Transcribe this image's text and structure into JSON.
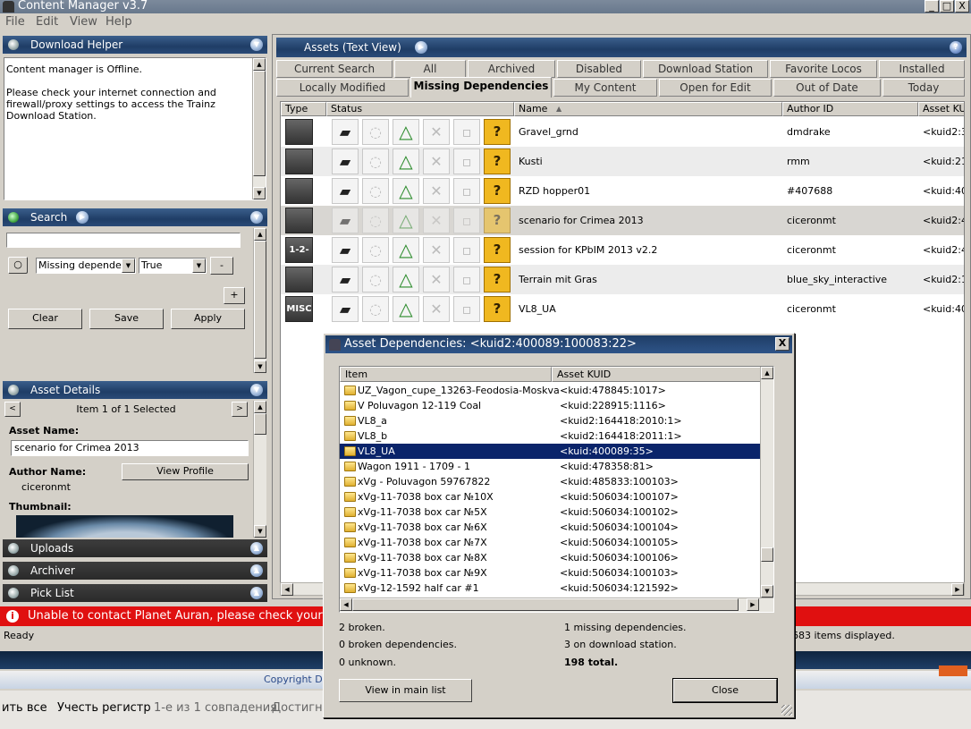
{
  "window": {
    "title": "Content Manager v3.7",
    "min": "_",
    "max": "□",
    "close": "X"
  },
  "menu": [
    "File",
    "Edit",
    "View",
    "Help"
  ],
  "download_helper": {
    "title": "Download Helper",
    "line1": "Content manager is Offline.",
    "line2": "Please check your internet connection and",
    "line3": "firewall/proxy settings to access the Trainz",
    "line4": "Download Station."
  },
  "search": {
    "title": "Search",
    "input_value": "",
    "field": "Missing dependenc",
    "value": "True",
    "minus": "-",
    "plus": "+",
    "clear": "Clear",
    "save": "Save",
    "apply": "Apply"
  },
  "asset_details": {
    "title": "Asset Details",
    "nav": "Item 1 of 1 Selected",
    "name_label": "Asset Name:",
    "name_value": "scenario for Crimea 2013",
    "author_label": "Author Name:",
    "author_value": "ciceronmt",
    "view_profile": "View Profile",
    "thumbnail_label": "Thumbnail:"
  },
  "panels": {
    "uploads": "Uploads",
    "archiver": "Archiver",
    "pick_list": "Pick List"
  },
  "assets": {
    "title": "Assets (Text View)",
    "tabs_row1": [
      "Current Search",
      "All",
      "Archived",
      "Disabled",
      "Download Station",
      "Favorite Locos",
      "Installed"
    ],
    "tabs_row2": [
      "Locally Modified",
      "Missing Dependencies",
      "My Content",
      "Open for Edit",
      "Out of Date",
      "Today"
    ],
    "columns": [
      "Type",
      "Status",
      "Name",
      "Author ID",
      "Asset KUI"
    ],
    "rows": [
      {
        "type": "",
        "name": "Gravel_grnd",
        "author": "dmdrake",
        "kuid": "<kuid2:33"
      },
      {
        "type": "",
        "name": "Kusti",
        "author": "rmm",
        "kuid": "<kuid:211"
      },
      {
        "type": "",
        "name": "RZD hopper01",
        "author": "#407688",
        "kuid": "<kuid:407"
      },
      {
        "type": "",
        "name": "scenario for Crimea 2013",
        "author": "ciceronmt",
        "kuid": "<kuid2:40"
      },
      {
        "type": "1-2-3-4",
        "name": "session for KPbIM 2013 v2.2",
        "author": "ciceronmt",
        "kuid": "<kuid2:40"
      },
      {
        "type": "",
        "name": "Terrain mit Gras",
        "author": "blue_sky_interactive",
        "kuid": "<kuid2:15"
      },
      {
        "type": "MISC",
        "name": "VL8_UA",
        "author": "ciceronmt",
        "kuid": "<kuid:400"
      }
    ],
    "status_q": "?"
  },
  "error_bar": "Unable to contact Planet Auran, please check your",
  "status_bar": {
    "left": "Ready",
    "right": "683 items displayed."
  },
  "copyright": "Copyright D",
  "taskbar": {
    "a": "ить все",
    "b": "Учесть регистр",
    "c": "1-е из 1 совпадения",
    "d": "Достигну"
  },
  "dialog": {
    "title": "Asset Dependencies: <kuid2:400089:100083:22>",
    "close_x": "X",
    "col_item": "Item",
    "col_kuid": "Asset KUID",
    "rows": [
      {
        "name": "UZ_Vagon_cupe_13263-Feodosia-Moskva",
        "kuid": "<kuid:478845:1017>"
      },
      {
        "name": "V Poluvagon 12-119 Coal",
        "kuid": "<kuid:228915:1116>"
      },
      {
        "name": "VL8_a",
        "kuid": "<kuid2:164418:2010:1>"
      },
      {
        "name": "VL8_b",
        "kuid": "<kuid2:164418:2011:1>"
      },
      {
        "name": "VL8_UA",
        "kuid": "<kuid:400089:35>"
      },
      {
        "name": "Wagon 1911 - 1709 - 1",
        "kuid": "<kuid:478358:81>"
      },
      {
        "name": "xVg - Poluvagon 59767822",
        "kuid": "<kuid:485833:100103>"
      },
      {
        "name": "xVg-11-7038 box car №10X",
        "kuid": "<kuid:506034:100107>"
      },
      {
        "name": "xVg-11-7038 box car №5X",
        "kuid": "<kuid:506034:100102>"
      },
      {
        "name": "xVg-11-7038 box car №6X",
        "kuid": "<kuid:506034:100104>"
      },
      {
        "name": "xVg-11-7038 box car №7X",
        "kuid": "<kuid:506034:100105>"
      },
      {
        "name": "xVg-11-7038 box car №8X",
        "kuid": "<kuid:506034:100106>"
      },
      {
        "name": "xVg-11-7038 box car №9X",
        "kuid": "<kuid:506034:100103>"
      },
      {
        "name": "xVg-12-1592 half car #1",
        "kuid": "<kuid:506034:121592>"
      }
    ],
    "selected_index": 4,
    "stats": {
      "broken": "2 broken.",
      "broken_deps": "0 broken dependencies.",
      "unknown": "0 unknown.",
      "missing": "1 missing dependencies.",
      "download": "3 on download station.",
      "total": "198 total."
    },
    "view_main": "View in main list",
    "close": "Close"
  }
}
